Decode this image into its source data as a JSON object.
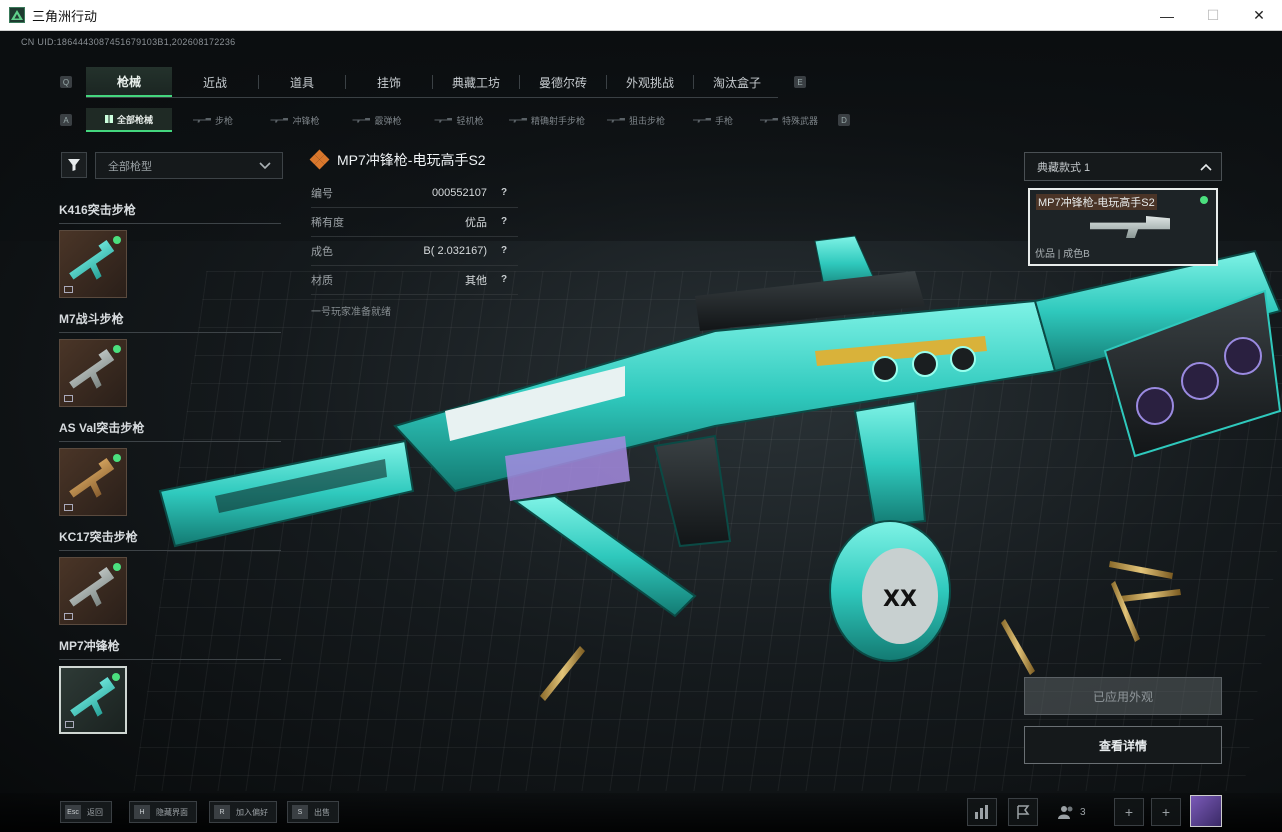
{
  "window": {
    "title": "三角洲行动",
    "controls": [
      "—",
      "☐",
      "✕"
    ]
  },
  "uid": "CN UID:1864443087451679103B1,202608172236",
  "main_tabs": {
    "left_key": "Q",
    "right_key": "E",
    "items": [
      {
        "label": "枪械",
        "active": true
      },
      {
        "label": "近战"
      },
      {
        "label": "道具"
      },
      {
        "label": "挂饰"
      },
      {
        "label": "典藏工坊"
      },
      {
        "label": "曼德尔砖"
      },
      {
        "label": "外观挑战"
      },
      {
        "label": "淘汰盒子"
      }
    ]
  },
  "sub_tabs": {
    "left_key": "A",
    "right_key": "D",
    "items": [
      {
        "label": "全部枪械",
        "active": true
      },
      {
        "label": "步枪"
      },
      {
        "label": "冲锋枪"
      },
      {
        "label": "霰弹枪"
      },
      {
        "label": "轻机枪"
      },
      {
        "label": "精确射手步枪"
      },
      {
        "label": "狙击步枪"
      },
      {
        "label": "手枪"
      },
      {
        "label": "特殊武器"
      }
    ]
  },
  "filter": {
    "type_select": "全部枪型"
  },
  "gun_groups": [
    {
      "title": "K416突击步枪",
      "skin": "teal",
      "selected": false
    },
    {
      "title": "M7战斗步枪",
      "skin": "silver",
      "selected": false
    },
    {
      "title": "AS Val突击步枪",
      "skin": "gold",
      "selected": false
    },
    {
      "title": "KC17突击步枪",
      "skin": "silver",
      "selected": false
    },
    {
      "title": "MP7冲锋枪",
      "skin": "teal",
      "selected": true
    }
  ],
  "info": {
    "title": "MP7冲锋枪-电玩高手S2",
    "rows": [
      {
        "key": "编号",
        "value": "000552107"
      },
      {
        "key": "稀有度",
        "value": "优品"
      },
      {
        "key": "成色",
        "value": "B( 2.032167)"
      },
      {
        "key": "材质",
        "value": "其他"
      }
    ],
    "note": "一号玩家准备就绪",
    "rarity_color": "#d9772c"
  },
  "style_panel": {
    "select": "典藏款式 1",
    "card": {
      "title": "MP7冲锋枪-电玩高手S2",
      "footer": "优品 | 成色B"
    }
  },
  "actions": {
    "applied": "已应用外观",
    "detail": "查看详情"
  },
  "bottom_hints": [
    {
      "key": "Esc",
      "label": "返回"
    },
    {
      "key": "H",
      "label": "隐藏界面"
    },
    {
      "key": "R",
      "label": "加入偏好"
    },
    {
      "key": "S",
      "label": "出售"
    }
  ],
  "bottom_icons": {
    "friends_count": "3"
  },
  "colors": {
    "accent": "#44d67e",
    "teal": "#2fc9bd",
    "rarity": "#d9772c"
  }
}
